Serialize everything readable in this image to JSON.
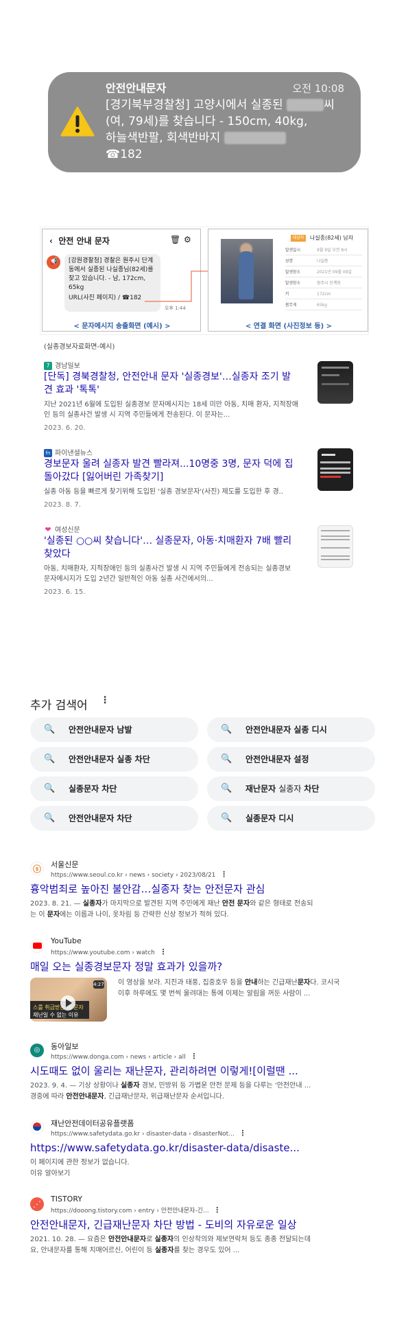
{
  "notification": {
    "sender": "안전안내문자",
    "time": "오전 10:08",
    "line1": "[경기북부경찰청] 고양시에서 실종된",
    "line1_tail": "씨",
    "line2": "(여, 79세)를 찾습니다 - 150cm, 40kg,",
    "line3": "하늘색반팔, 회색반바지",
    "line4": "☎182"
  },
  "figure": {
    "phone_header": "안전 안내 문자",
    "message": "[강원경찰청] 경찰은 원주시 단계동에서 실종된 나실종님(82세)를 찾고 있습니다. - 남, 172cm, 65kg",
    "message_link": "URL(사진 페이지) / ☎182",
    "message_time": "오후 1:44",
    "phone_caption": "< 문자메시지 송출화면 (예시) >",
    "link_tag": "대상자",
    "link_name": "나실종(82세) 남자",
    "info": [
      {
        "k": "발생일시",
        "v": "9월 9일 오전 8시"
      },
      {
        "k": "성명",
        "v": "나실종"
      },
      {
        "k": "발생장소",
        "v": "2021년 09월 09일"
      },
      {
        "k": "발생장소",
        "v": "원주시 단계동"
      },
      {
        "k": "키",
        "v": "172cm"
      },
      {
        "k": "몸무게",
        "v": "65kg"
      }
    ],
    "link_caption": "< 연결 화면 (사진정보 등) >",
    "caption": "(실종경보자료화면-예시)"
  },
  "news": [
    {
      "source": "경남일보",
      "icon_color": "#14a085",
      "icon_char": "7",
      "title1": "[단독] 경북경찰청, 안전안내 문자 '실종경보'…실종자 조기 발",
      "title2": "견 효과 '톡톡'",
      "snip1": "지난 2021년 6월에 도입된 실종경보 문자메시지는 18세 미만 아동, 치매 환자, 지적장애",
      "snip2": "인 등의 실종사건 발생 시 지역 주민들에게 전송된다. 이 문자는...",
      "date": "2023. 6. 20."
    },
    {
      "source": "파이낸셜뉴스",
      "icon_color": "#1c5bb5",
      "icon_char": "fn",
      "title1": "경보문자 울려 실종자 발견 빨라져...10명중 3명, 문자 덕에 집",
      "title2": "돌아갔다 [잃어버린 가족찾기]",
      "snip1": "실종 아동 등을 빠르게 찾기위해 도입된 '실종 경보문자'(사진) 제도를 도입한 후 경..",
      "snip2": "",
      "date": "2023. 8. 7."
    },
    {
      "source": "여성신문",
      "icon_color": "#e84393",
      "icon_char": "❤",
      "title1": "'실종된 ○○씨 찾습니다'… 실종문자, 아동·치매환자 7배 빨리",
      "title2": "찾았다",
      "snip1": "아동, 치매환자, 지적장애인 등의 실종사건 발생 시 지역 주민들에게 전송되는 실종경보",
      "snip2": "문자메시지가 도입 2년간 일반적인 아동 실종 사건에서의...",
      "date": "2023. 6. 15."
    }
  ],
  "related": {
    "heading": "추가 검색어",
    "items": [
      {
        "pre": "안전안내문자 남발",
        "mid": "",
        "post": ""
      },
      {
        "pre": "안전안내문자 실종 디시",
        "mid": "",
        "post": ""
      },
      {
        "pre": "안전안내문자 실종 차단",
        "mid": "",
        "post": ""
      },
      {
        "pre": "안전안내문자 설정",
        "mid": "",
        "post": ""
      },
      {
        "pre": "실종문자 차단",
        "mid": "",
        "post": ""
      },
      {
        "pre": "재난문자 ",
        "mid": "실종자 ",
        "post": "차단"
      },
      {
        "pre": "안전안내문자 차단",
        "mid": "",
        "post": ""
      },
      {
        "pre": "실종문자 디시",
        "mid": "",
        "post": ""
      }
    ]
  },
  "results": [
    {
      "site": "서울신문",
      "url": "https://www.seoul.co.kr › news › society › 2023/08/21",
      "title": "흉악범죄로 높아진 불안감…실종자 찾는 안전문자 관심",
      "snip1": [
        [
          "2023. 8. 21. — ",
          0
        ],
        [
          "실종자",
          1
        ],
        [
          "가 마지막으로 발견된 지역 주민에게 재난 ",
          0
        ],
        [
          "안전 문자",
          1
        ],
        [
          "와 같은 형태로 전송되",
          0
        ]
      ],
      "snip2": [
        [
          "는 이 ",
          0
        ],
        [
          "문자",
          1
        ],
        [
          "에는 이름과 나이, 옷차림 등 간략한 신상 정보가 적혀 있다.",
          0
        ]
      ]
    },
    {
      "site": "YouTube",
      "url": "https://www.youtube.com › watch",
      "title": "매일 오는 실종경보문자 정말 효과가 있을까?",
      "snip1": [
        [
          "이 영상을 보라. 지진과 태풍, 집중호우 등을 ",
          0
        ],
        [
          "안내",
          1
        ],
        [
          "하는 긴급재난",
          0
        ],
        [
          "문자",
          1
        ],
        [
          "다. 코시국",
          0
        ]
      ],
      "snip2": [
        [
          "이후 하루에도 몇 번씩 울려대는 통에 이제는 알림을 꺼둔 사람이 ...",
          0
        ]
      ],
      "thumb_line1": "스를 취급받는 이 문자",
      "thumb_line2": "재난일 수 없는 이유",
      "thumb_duration": "4:27"
    },
    {
      "site": "동아일보",
      "url": "https://www.donga.com › news › article › all",
      "title": "시도때도 없이 울리는 재난문자, 관리하려면 이렇게![이럴땐 ...",
      "snip1": [
        [
          "2023. 9. 4. — 기상 상황이나 ",
          0
        ],
        [
          "실종자",
          1
        ],
        [
          " 경보, 민방위 등 가볍운 안전 문제 등을 다루는 '안전안내 ...",
          0
        ]
      ],
      "snip2": [
        [
          "경중에 따라 ",
          0
        ],
        [
          "안전안내문자",
          1
        ],
        [
          ", 긴급재난문자, 위급재난문자 순서입니다.",
          0
        ]
      ]
    },
    {
      "site": "재난안전데이터공유플랫폼",
      "url": "https://www.safetydata.go.kr › disaster-data › disasterNot...",
      "title": "https://www.safetydata.go.kr/disaster-data/disaste...",
      "snip1": [
        [
          "이 페이지에 관한 정보가 없습니다.",
          0
        ]
      ],
      "snip2": [
        [
          "이유 알아보기",
          0
        ]
      ]
    },
    {
      "site": "TISTORY",
      "url": "https://dooong.tistory.com › entry › 안전안내문자-긴...",
      "title": "안전안내문자, 긴급재난문자 차단 방법 - 도비의 자유로운 일상",
      "snip1": [
        [
          "2021. 10. 28. — 요즘은 ",
          0
        ],
        [
          "안전안내문자",
          1
        ],
        [
          "로 ",
          0
        ],
        [
          "실종자",
          1
        ],
        [
          "의 인상착의와 제보연락처 등도 종종 전달되는데",
          0
        ]
      ],
      "snip2": [
        [
          "요, 안내문자를 통해 치매어르신, 어린이 등 ",
          0
        ],
        [
          "실종자",
          1
        ],
        [
          "를 찾는 경우도 있어 ...",
          0
        ]
      ]
    }
  ],
  "colors": {
    "link": "#1a0dab",
    "chip_bg": "#f1f3f4",
    "banner_bg": "#8e8e8e"
  }
}
